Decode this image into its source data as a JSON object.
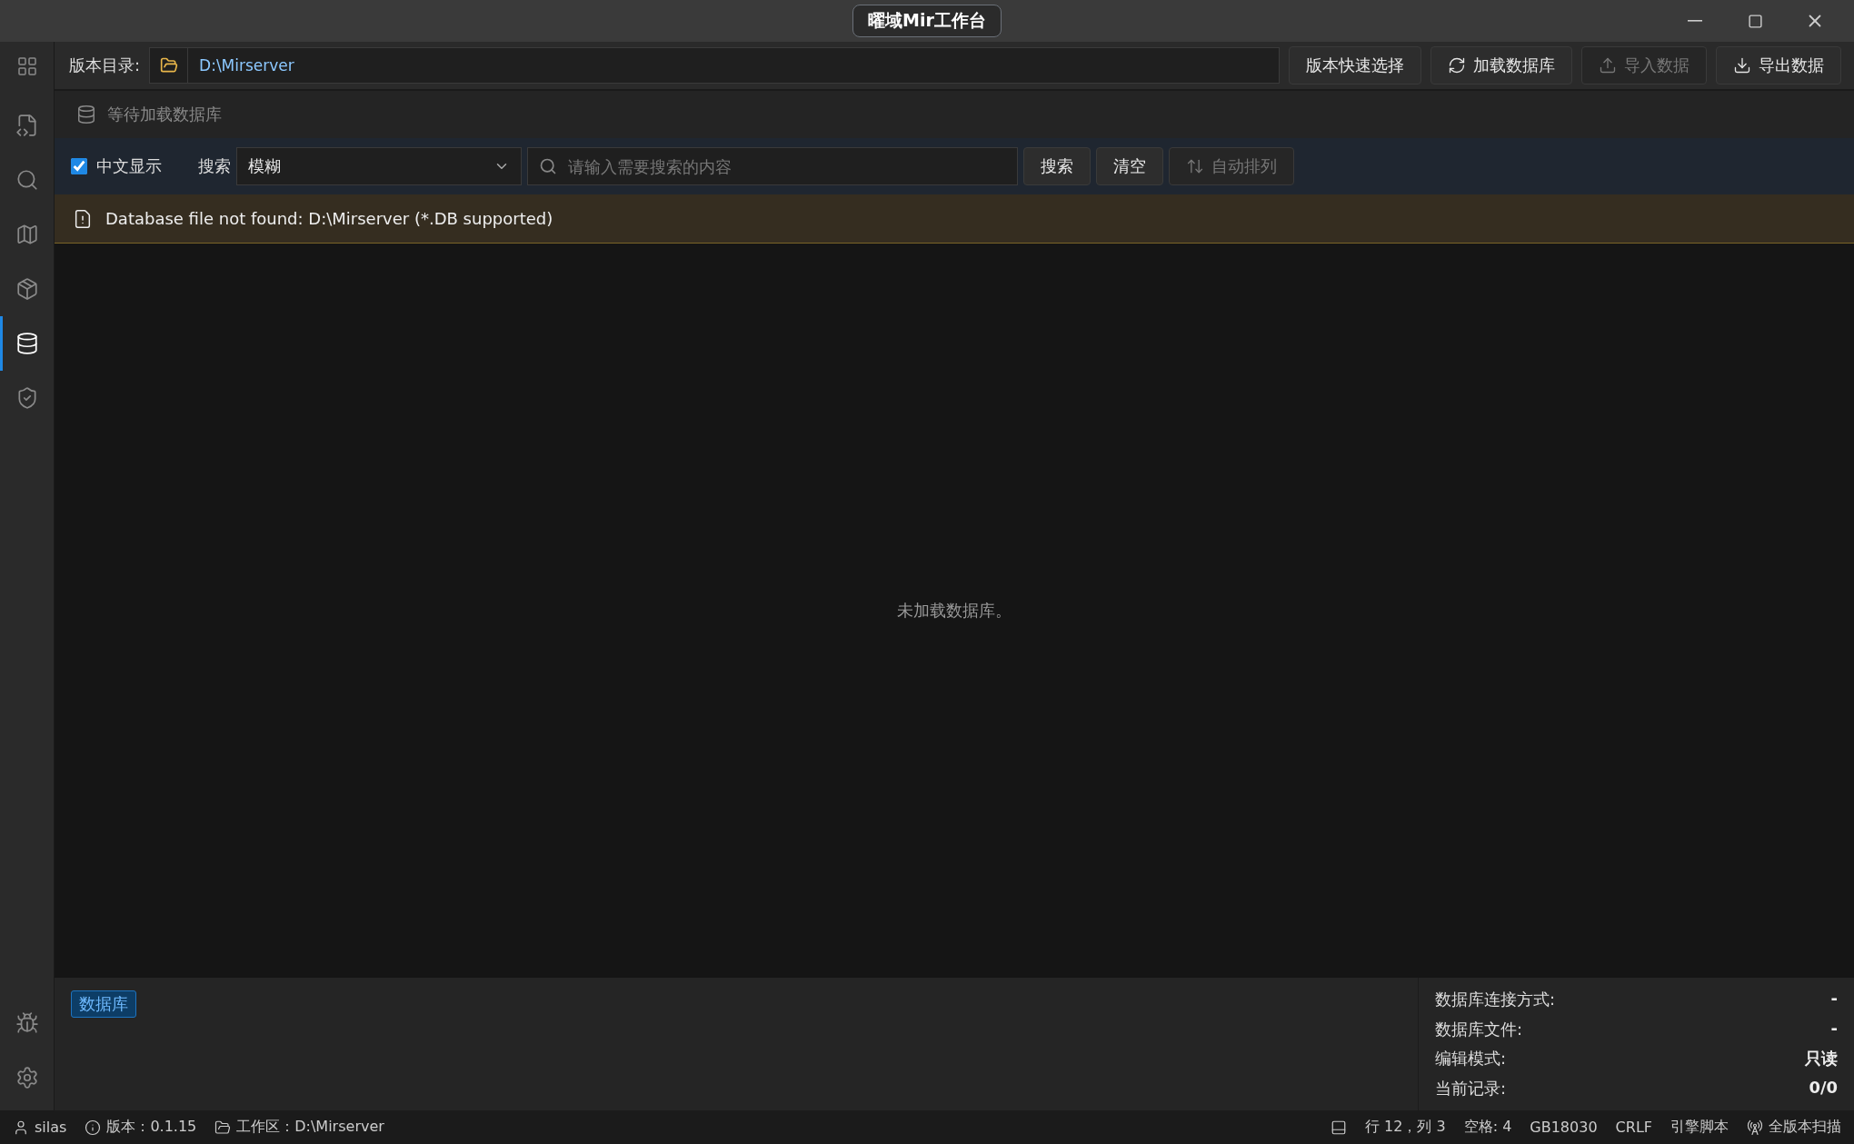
{
  "window": {
    "title": "曜域Mir工作台"
  },
  "sidebar": {
    "items": [
      {
        "kind": "file-code",
        "selected": false
      },
      {
        "kind": "search",
        "selected": false
      },
      {
        "kind": "map",
        "selected": false
      },
      {
        "kind": "package",
        "selected": false
      },
      {
        "kind": "database",
        "selected": true
      },
      {
        "kind": "shield",
        "selected": false
      }
    ],
    "bottom_items": [
      {
        "kind": "bug"
      },
      {
        "kind": "settings"
      }
    ]
  },
  "toolbar": {
    "dir_label": "版本目录:",
    "dir_value": "D:\\Mirserver",
    "buttons": [
      {
        "kind": "plain",
        "label": "版本快速选择",
        "disabled": false
      },
      {
        "kind": "refresh",
        "label": "加载数据库",
        "disabled": false
      },
      {
        "kind": "upload",
        "label": "导入数据",
        "disabled": true
      },
      {
        "kind": "download",
        "label": "导出数据",
        "disabled": false
      }
    ]
  },
  "status_line": "等待加载数据库",
  "search_bar": {
    "checkbox": {
      "label": "中文显示",
      "checked": true
    },
    "search_label": "搜索",
    "mode": "模糊",
    "placeholder": "请输入需要搜索的内容",
    "buttons": [
      {
        "kind": "plain",
        "label": "搜索",
        "disabled": false
      },
      {
        "kind": "plain",
        "label": "清空",
        "disabled": false
      },
      {
        "kind": "sort",
        "label": "自动排列",
        "disabled": true
      }
    ]
  },
  "warning": "Database file not found: D:\\Mirserver (*.DB supported)",
  "empty_message": "未加载数据库。",
  "bottom_panel": {
    "tag": "数据库",
    "info": [
      {
        "label": "数据库连接方式:",
        "value": "-"
      },
      {
        "label": "数据库文件:",
        "value": "-"
      },
      {
        "label": "编辑模式:",
        "value": "只读"
      },
      {
        "label": "当前记录:",
        "value": "0/0"
      }
    ]
  },
  "status_bar": {
    "left": [
      {
        "kind": "user",
        "text": "silas"
      },
      {
        "kind": "info",
        "text": "版本：0.1.15"
      },
      {
        "kind": "folder",
        "text": "工作区：D:\\Mirserver"
      }
    ],
    "right": [
      {
        "kind": "panel"
      },
      {
        "kind": "none",
        "text": "行 12，列 3"
      },
      {
        "kind": "none",
        "text": "空格: 4"
      },
      {
        "kind": "none",
        "text": "GB18030"
      },
      {
        "kind": "none",
        "text": "CRLF"
      },
      {
        "kind": "none",
        "text": "引擎脚本"
      },
      {
        "kind": "antenna",
        "text": "全版本扫描"
      }
    ]
  }
}
